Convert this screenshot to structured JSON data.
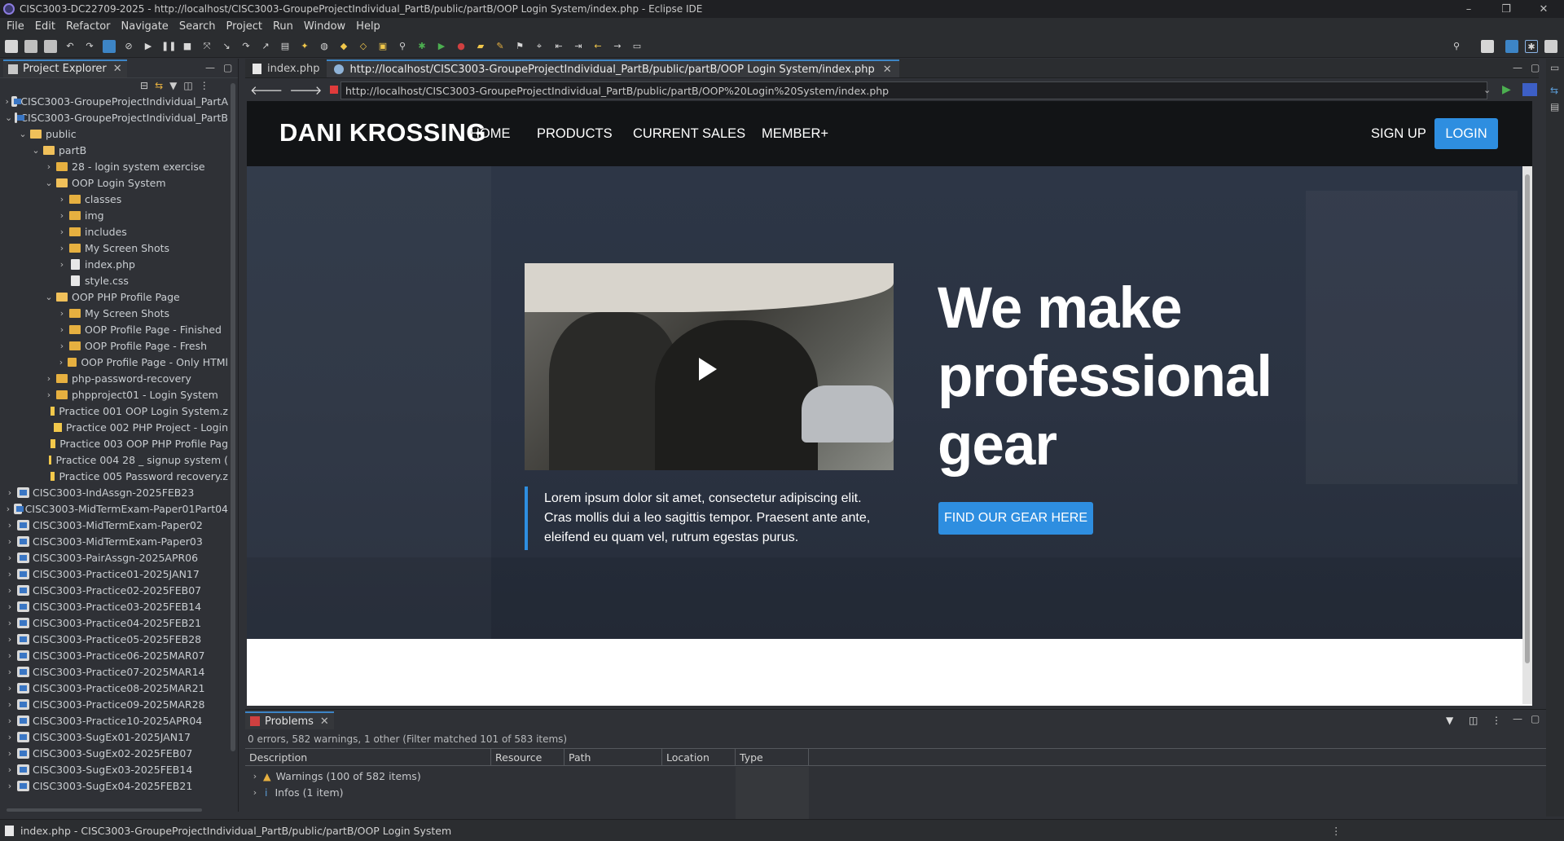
{
  "window": {
    "title": "CISC3003-DC22709-2025 - http://localhost/CISC3003-GroupeProjectIndividual_PartB/public/partB/OOP Login System/index.php - Eclipse IDE",
    "min": "–",
    "max": "❐",
    "close": "✕"
  },
  "menu": [
    "File",
    "Edit",
    "Refactor",
    "Navigate",
    "Search",
    "Project",
    "Run",
    "Window",
    "Help"
  ],
  "project_explorer": {
    "tab_label": "Project Explorer",
    "tree": [
      {
        "label": "CISC3003-GroupeProjectIndividual_PartA",
        "depth": 0,
        "kind": "project",
        "open": false
      },
      {
        "label": "CISC3003-GroupeProjectIndividual_PartB",
        "depth": 0,
        "kind": "project",
        "open": true
      },
      {
        "label": "public",
        "depth": 1,
        "kind": "folder",
        "open": true
      },
      {
        "label": "partB",
        "depth": 2,
        "kind": "folder",
        "open": true
      },
      {
        "label": "28 - login system exercise",
        "depth": 3,
        "kind": "folder",
        "open": false
      },
      {
        "label": "OOP Login System",
        "depth": 3,
        "kind": "folder",
        "open": true
      },
      {
        "label": "classes",
        "depth": 4,
        "kind": "folder",
        "open": false
      },
      {
        "label": "img",
        "depth": 4,
        "kind": "folder",
        "open": false
      },
      {
        "label": "includes",
        "depth": 4,
        "kind": "folder",
        "open": false
      },
      {
        "label": "My Screen Shots",
        "depth": 4,
        "kind": "folder",
        "open": false
      },
      {
        "label": "index.php",
        "depth": 4,
        "kind": "file",
        "open": false
      },
      {
        "label": "style.css",
        "depth": 4,
        "kind": "file-leaf",
        "open": false
      },
      {
        "label": "OOP PHP Profile Page",
        "depth": 3,
        "kind": "folder",
        "open": true
      },
      {
        "label": "My Screen Shots",
        "depth": 4,
        "kind": "folder",
        "open": false
      },
      {
        "label": "OOP Profile Page - Finished",
        "depth": 4,
        "kind": "folder",
        "open": false
      },
      {
        "label": "OOP Profile Page - Fresh",
        "depth": 4,
        "kind": "folder",
        "open": false
      },
      {
        "label": "OOP Profile Page - Only HTMl",
        "depth": 4,
        "kind": "folder",
        "open": false
      },
      {
        "label": "php-password-recovery",
        "depth": 3,
        "kind": "folder",
        "open": false
      },
      {
        "label": "phpproject01 - Login System",
        "depth": 3,
        "kind": "folder",
        "open": false
      },
      {
        "label": "Practice 001 OOP Login System.z",
        "depth": 3,
        "kind": "zip",
        "open": false
      },
      {
        "label": "Practice 002 PHP Project - Login",
        "depth": 3,
        "kind": "zip",
        "open": false
      },
      {
        "label": "Practice 003 OOP PHP Profile Pag",
        "depth": 3,
        "kind": "zip",
        "open": false
      },
      {
        "label": "Practice 004 28 _ signup system (",
        "depth": 3,
        "kind": "zip",
        "open": false
      },
      {
        "label": "Practice 005 Password recovery.z",
        "depth": 3,
        "kind": "zip",
        "open": false
      },
      {
        "label": "CISC3003-IndAssgn-2025FEB23",
        "depth": 0,
        "kind": "project",
        "open": false
      },
      {
        "label": "CISC3003-MidTermExam-Paper01Part04",
        "depth": 0,
        "kind": "project",
        "open": false
      },
      {
        "label": "CISC3003-MidTermExam-Paper02",
        "depth": 0,
        "kind": "project",
        "open": false
      },
      {
        "label": "CISC3003-MidTermExam-Paper03",
        "depth": 0,
        "kind": "project",
        "open": false
      },
      {
        "label": "CISC3003-PairAssgn-2025APR06",
        "depth": 0,
        "kind": "project",
        "open": false
      },
      {
        "label": "CISC3003-Practice01-2025JAN17",
        "depth": 0,
        "kind": "project",
        "open": false
      },
      {
        "label": "CISC3003-Practice02-2025FEB07",
        "depth": 0,
        "kind": "project",
        "open": false
      },
      {
        "label": "CISC3003-Practice03-2025FEB14",
        "depth": 0,
        "kind": "project",
        "open": false
      },
      {
        "label": "CISC3003-Practice04-2025FEB21",
        "depth": 0,
        "kind": "project",
        "open": false
      },
      {
        "label": "CISC3003-Practice05-2025FEB28",
        "depth": 0,
        "kind": "project",
        "open": false
      },
      {
        "label": "CISC3003-Practice06-2025MAR07",
        "depth": 0,
        "kind": "project",
        "open": false
      },
      {
        "label": "CISC3003-Practice07-2025MAR14",
        "depth": 0,
        "kind": "project",
        "open": false
      },
      {
        "label": "CISC3003-Practice08-2025MAR21",
        "depth": 0,
        "kind": "project",
        "open": false
      },
      {
        "label": "CISC3003-Practice09-2025MAR28",
        "depth": 0,
        "kind": "project",
        "open": false
      },
      {
        "label": "CISC3003-Practice10-2025APR04",
        "depth": 0,
        "kind": "project",
        "open": false
      },
      {
        "label": "CISC3003-SugEx01-2025JAN17",
        "depth": 0,
        "kind": "project",
        "open": false
      },
      {
        "label": "CISC3003-SugEx02-2025FEB07",
        "depth": 0,
        "kind": "project",
        "open": false
      },
      {
        "label": "CISC3003-SugEx03-2025FEB14",
        "depth": 0,
        "kind": "project",
        "open": false
      },
      {
        "label": "CISC3003-SugEx04-2025FEB21",
        "depth": 0,
        "kind": "project",
        "open": false
      }
    ]
  },
  "editor": {
    "tabs": [
      {
        "label": "index.php",
        "active": false
      },
      {
        "label": "http://localhost/CISC3003-GroupeProjectIndividual_PartB/public/partB/OOP Login System/index.php",
        "active": true
      }
    ],
    "url": "http://localhost/CISC3003-GroupeProjectIndividual_PartB/public/partB/OOP%20Login%20System/index.php"
  },
  "site": {
    "logo": "DANI KROSSING",
    "nav": [
      "HOME",
      "PRODUCTS",
      "CURRENT SALES",
      "MEMBER+"
    ],
    "signup": "SIGN UP",
    "login": "LOGIN",
    "headline": "We make professional gear",
    "quote": "Lorem ipsum dolor sit amet, consectetur adipiscing elit. Cras mollis dui a leo sagittis tempor. Praesent ante ante, eleifend eu quam vel, rutrum egestas purus.",
    "cta": "FIND OUR GEAR HERE",
    "accent": "#2e8ee0"
  },
  "problems": {
    "tab_label": "Problems",
    "summary": "0 errors, 582 warnings, 1 other (Filter matched 101 of 583 items)",
    "columns": [
      "Description",
      "Resource",
      "Path",
      "Location",
      "Type"
    ],
    "rows": [
      {
        "label": "Warnings (100 of 582 items)",
        "icon": "warning-icon"
      },
      {
        "label": "Infos (1 item)",
        "icon": "info-icon"
      }
    ]
  },
  "status": {
    "text": "index.php - CISC3003-GroupeProjectIndividual_PartB/public/partB/OOP Login System"
  }
}
